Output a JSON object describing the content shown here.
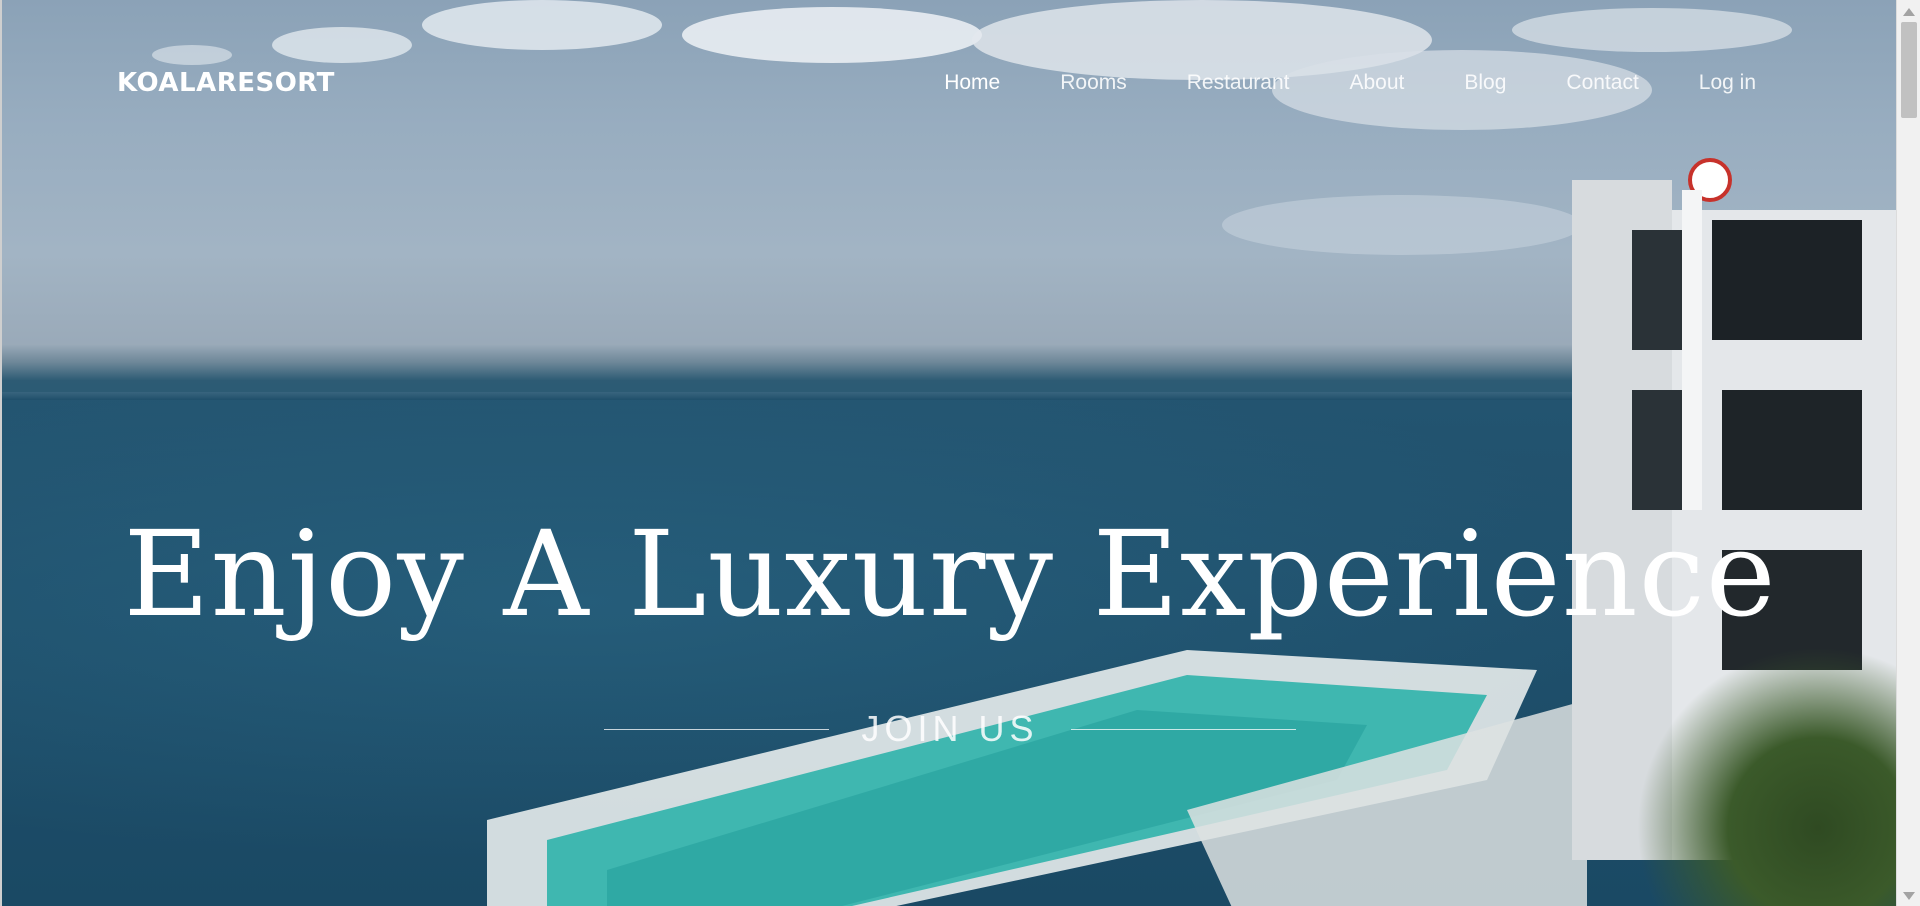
{
  "brand": {
    "name": "KOALARESORT"
  },
  "nav": {
    "items": [
      {
        "label": "Home",
        "active": true
      },
      {
        "label": "Rooms",
        "active": false
      },
      {
        "label": "Restaurant",
        "active": false
      },
      {
        "label": "About",
        "active": false
      },
      {
        "label": "Blog",
        "active": false
      },
      {
        "label": "Contact",
        "active": false
      },
      {
        "label": "Log in",
        "active": false
      }
    ]
  },
  "hero": {
    "headline": "Enjoy A Luxury Experience",
    "cta_label": "JOIN US",
    "background_icon": "ocean-resort-photo"
  },
  "colors": {
    "text": "#ffffff",
    "sea": "#1f4f6b",
    "sky": "#98adc0"
  }
}
